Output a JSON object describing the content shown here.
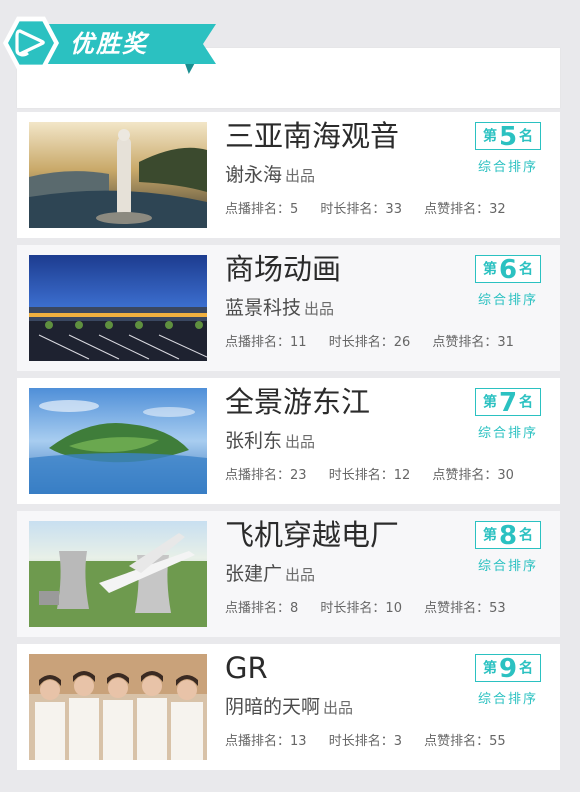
{
  "banner": {
    "title": "优胜奖",
    "icon": "play-icon",
    "accent": "#2bc1c1"
  },
  "labels": {
    "produced": "出品",
    "rank_prefix": "第",
    "rank_suffix": "名",
    "rank_caption": "综合排序"
  },
  "entries": [
    {
      "title": "三亚南海观音",
      "author": "谢永海",
      "rank": "5",
      "stats": {
        "play": "点播排名：5",
        "duration": "时长排名：33",
        "likes": "点赞排名：32"
      }
    },
    {
      "title": "商场动画",
      "author": "蓝景科技",
      "rank": "6",
      "stats": {
        "play": "点播排名：11",
        "duration": "时长排名：26",
        "likes": "点赞排名：31"
      }
    },
    {
      "title": "全景游东江",
      "author": "张利东",
      "rank": "7",
      "stats": {
        "play": "点播排名：23",
        "duration": "时长排名：12",
        "likes": "点赞排名：30"
      }
    },
    {
      "title": "飞机穿越电厂",
      "author": "张建广",
      "rank": "8",
      "stats": {
        "play": "点播排名：8",
        "duration": "时长排名：10",
        "likes": "点赞排名：53"
      }
    },
    {
      "title": "GR",
      "author": "阴暗的天啊",
      "rank": "9",
      "stats": {
        "play": "点播排名：13",
        "duration": "时长排名：3",
        "likes": "点赞排名：55"
      }
    }
  ]
}
